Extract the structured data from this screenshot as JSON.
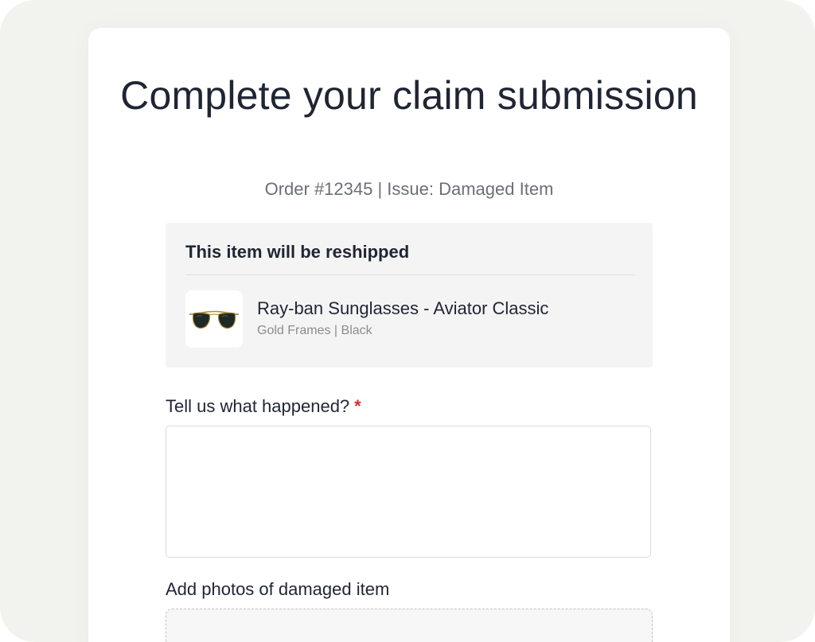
{
  "header": {
    "title": "Complete your claim submission",
    "subtitle": "Order #12345 | Issue: Damaged Item"
  },
  "reship_panel": {
    "heading": "This item will be reshipped",
    "product": {
      "name": "Ray-ban Sunglasses - Aviator Classic",
      "variant": "Gold Frames | Black",
      "image_icon": "aviator-sunglasses-icon"
    }
  },
  "form": {
    "what_happened_label": "Tell us what happened?",
    "required_marker": "*",
    "what_happened_value": "",
    "photos_label": "Add photos of damaged item"
  },
  "colors": {
    "required": "#d32f2f",
    "text": "#1f2533",
    "muted": "#6b6f76",
    "panel_bg": "#f4f4f4",
    "page_bg": "#f2f2ee"
  }
}
